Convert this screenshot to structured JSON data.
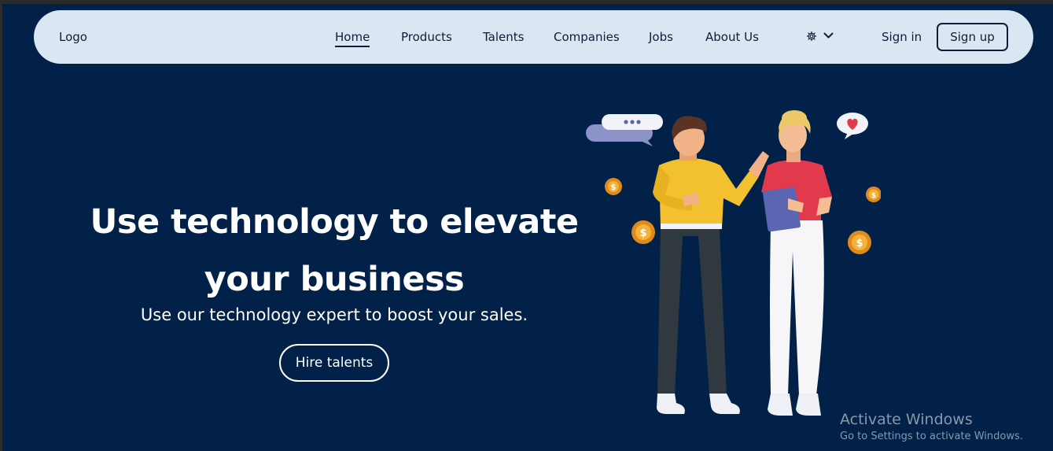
{
  "nav": {
    "logo": "Logo",
    "links": [
      "Home",
      "Products",
      "Talents",
      "Companies",
      "Jobs",
      "About Us"
    ],
    "active": "Home",
    "settings_icon": "gear-icon",
    "dropdown_icon": "chevron-down-icon",
    "signin": "Sign in",
    "signup": "Sign up"
  },
  "hero": {
    "title_line1": "Use technology to elevate",
    "title_line2": "your business",
    "subtitle": "Use our technology expert to boost your sales.",
    "cta": "Hire talents"
  },
  "watermark": {
    "title": "Activate Windows",
    "subtitle": "Go to Settings to activate Windows."
  },
  "colors": {
    "background": "#012148",
    "navbar": "#dae6f2",
    "nav_text": "#0e1e3a"
  }
}
